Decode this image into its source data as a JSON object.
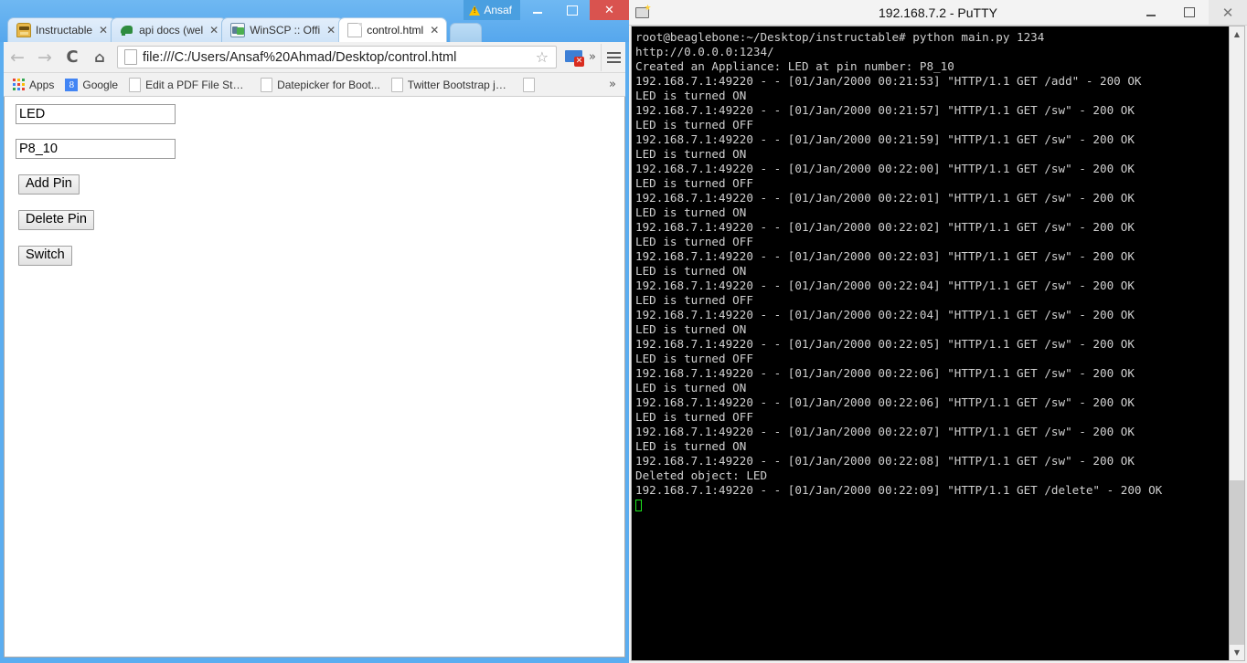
{
  "browser": {
    "window_user_button": "Ansaf",
    "window_controls": {
      "minimize": "–",
      "maximize": "□",
      "close": "✕"
    },
    "tabs": [
      {
        "title": "Instructable ",
        "favicon": "robot-icon",
        "active": false,
        "close": "✕"
      },
      {
        "title": "api docs (wel",
        "favicon": "dinosaur-icon",
        "active": false,
        "close": "✕"
      },
      {
        "title": "WinSCP :: Offi",
        "favicon": "winscp-icon",
        "active": false,
        "close": "✕"
      },
      {
        "title": "control.html",
        "favicon": "document-icon",
        "active": true,
        "close": "✕"
      }
    ],
    "toolbar": {
      "back": "←",
      "forward": "→",
      "reload": "C",
      "home": "⌂",
      "url": "file:///C:/Users/Ansaf%20Ahmad/Desktop/control.html",
      "star": "☆",
      "extension_badge": "✕",
      "overflow": "»",
      "menu": "menu-icon"
    },
    "bookmarks": [
      {
        "label": "Apps",
        "icon": "apps-grid-icon"
      },
      {
        "label": "Google",
        "icon": "google-g-icon"
      },
      {
        "label": "Edit a PDF File Step ...",
        "icon": "document-icon"
      },
      {
        "label": "Datepicker for Boot...",
        "icon": "document-icon"
      },
      {
        "label": "Twitter Bootstrap jQ...",
        "icon": "document-icon"
      },
      {
        "label": "",
        "icon": "document-icon"
      }
    ],
    "bookmarks_overflow": "»"
  },
  "page": {
    "name_input_value": "LED",
    "pin_input_value": "P8_10",
    "buttons": {
      "add": "Add Pin",
      "delete": "Delete Pin",
      "switch": "Switch"
    }
  },
  "putty": {
    "title": "192.168.7.2 - PuTTY",
    "window_controls": {
      "minimize": "–",
      "maximize": "□",
      "close": "✕"
    },
    "scrollbar": {
      "up": "▲",
      "down": "▼"
    },
    "terminal_lines": [
      "root@beaglebone:~/Desktop/instructable# python main.py 1234",
      "http://0.0.0.0:1234/",
      "Created an Appliance: LED at pin number: P8_10",
      "192.168.7.1:49220 - - [01/Jan/2000 00:21:53] \"HTTP/1.1 GET /add\" - 200 OK",
      "LED is turned ON",
      "192.168.7.1:49220 - - [01/Jan/2000 00:21:57] \"HTTP/1.1 GET /sw\" - 200 OK",
      "LED is turned OFF",
      "192.168.7.1:49220 - - [01/Jan/2000 00:21:59] \"HTTP/1.1 GET /sw\" - 200 OK",
      "LED is turned ON",
      "192.168.7.1:49220 - - [01/Jan/2000 00:22:00] \"HTTP/1.1 GET /sw\" - 200 OK",
      "LED is turned OFF",
      "192.168.7.1:49220 - - [01/Jan/2000 00:22:01] \"HTTP/1.1 GET /sw\" - 200 OK",
      "LED is turned ON",
      "192.168.7.1:49220 - - [01/Jan/2000 00:22:02] \"HTTP/1.1 GET /sw\" - 200 OK",
      "LED is turned OFF",
      "192.168.7.1:49220 - - [01/Jan/2000 00:22:03] \"HTTP/1.1 GET /sw\" - 200 OK",
      "LED is turned ON",
      "192.168.7.1:49220 - - [01/Jan/2000 00:22:04] \"HTTP/1.1 GET /sw\" - 200 OK",
      "LED is turned OFF",
      "192.168.7.1:49220 - - [01/Jan/2000 00:22:04] \"HTTP/1.1 GET /sw\" - 200 OK",
      "LED is turned ON",
      "192.168.7.1:49220 - - [01/Jan/2000 00:22:05] \"HTTP/1.1 GET /sw\" - 200 OK",
      "LED is turned OFF",
      "192.168.7.1:49220 - - [01/Jan/2000 00:22:06] \"HTTP/1.1 GET /sw\" - 200 OK",
      "LED is turned ON",
      "192.168.7.1:49220 - - [01/Jan/2000 00:22:06] \"HTTP/1.1 GET /sw\" - 200 OK",
      "LED is turned OFF",
      "192.168.7.1:49220 - - [01/Jan/2000 00:22:07] \"HTTP/1.1 GET /sw\" - 200 OK",
      "LED is turned ON",
      "192.168.7.1:49220 - - [01/Jan/2000 00:22:08] \"HTTP/1.1 GET /sw\" - 200 OK",
      "Deleted object: LED",
      "192.168.7.1:49220 - - [01/Jan/2000 00:22:09] \"HTTP/1.1 GET /delete\" - 200 OK"
    ]
  },
  "colors": {
    "chrome_frame": "#5badf0",
    "terminal_bg": "#000000",
    "terminal_fg": "#d0d0d0",
    "cursor": "#1ee81e",
    "close_button": "#d9534f"
  }
}
